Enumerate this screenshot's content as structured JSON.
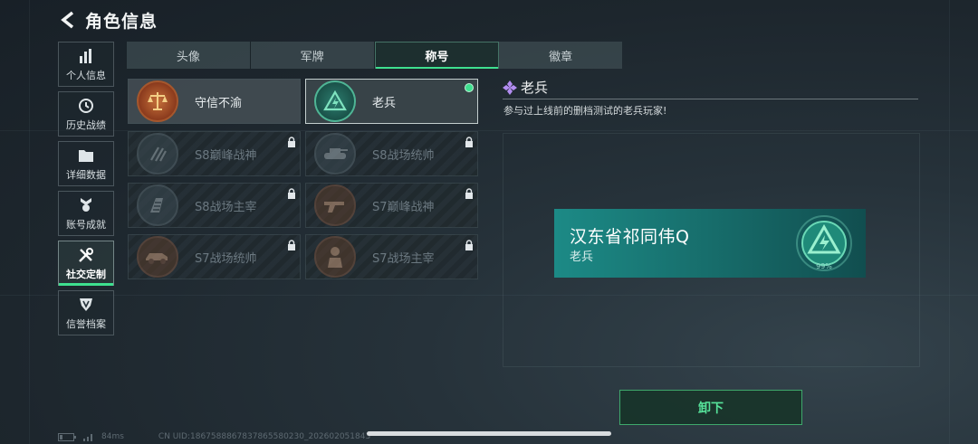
{
  "header": {
    "title": "角色信息",
    "back_icon": "back-arrow-icon"
  },
  "sidebar": {
    "items": [
      {
        "label": "个人信息",
        "icon": "bar-chart-icon",
        "active": false
      },
      {
        "label": "历史战绩",
        "icon": "clock-history-icon",
        "active": false
      },
      {
        "label": "详细数据",
        "icon": "folder-icon",
        "active": false
      },
      {
        "label": "账号成就",
        "icon": "medal-icon",
        "active": false
      },
      {
        "label": "社交定制",
        "icon": "tools-icon",
        "active": true
      },
      {
        "label": "信誉档案",
        "icon": "shield-badge-icon",
        "active": false
      }
    ]
  },
  "tabs": [
    {
      "label": "头像",
      "active": false
    },
    {
      "label": "军牌",
      "active": false
    },
    {
      "label": "称号",
      "active": true
    },
    {
      "label": "徽章",
      "active": false
    }
  ],
  "titles": [
    {
      "name": "守信不渝",
      "state": "unlocked",
      "icon": "scales-emblem-icon"
    },
    {
      "name": "老兵",
      "state": "selected",
      "icon": "veteran-emblem-icon"
    },
    {
      "name": "S8巅峰战神",
      "state": "locked",
      "icon": "slash-emblem-icon"
    },
    {
      "name": "S8战场统帅",
      "state": "locked",
      "icon": "tank-emblem-icon"
    },
    {
      "name": "S8战场主宰",
      "state": "locked",
      "icon": "building-emblem-icon"
    },
    {
      "name": "S7巅峰战神",
      "state": "locked",
      "icon": "gun-emblem-icon"
    },
    {
      "name": "S7战场统帅",
      "state": "locked",
      "icon": "vehicle-emblem-icon"
    },
    {
      "name": "S7战场主宰",
      "state": "locked",
      "icon": "soldier-emblem-icon"
    }
  ],
  "detail": {
    "name": "老兵",
    "description": "参与过上线前的删档测试的老兵玩家!",
    "icon": "purple-diamond-icon"
  },
  "preview": {
    "player_name": "汉东省祁同伟Q",
    "title": "老兵",
    "emblem_percent": "99%"
  },
  "unequip_button": "卸下",
  "footer": {
    "ping": "84ms",
    "uid": "CN UID:1867588867837865580230_202602051843"
  },
  "colors": {
    "accent": "#3ee08f",
    "preview_bg": "#1c8a86"
  }
}
